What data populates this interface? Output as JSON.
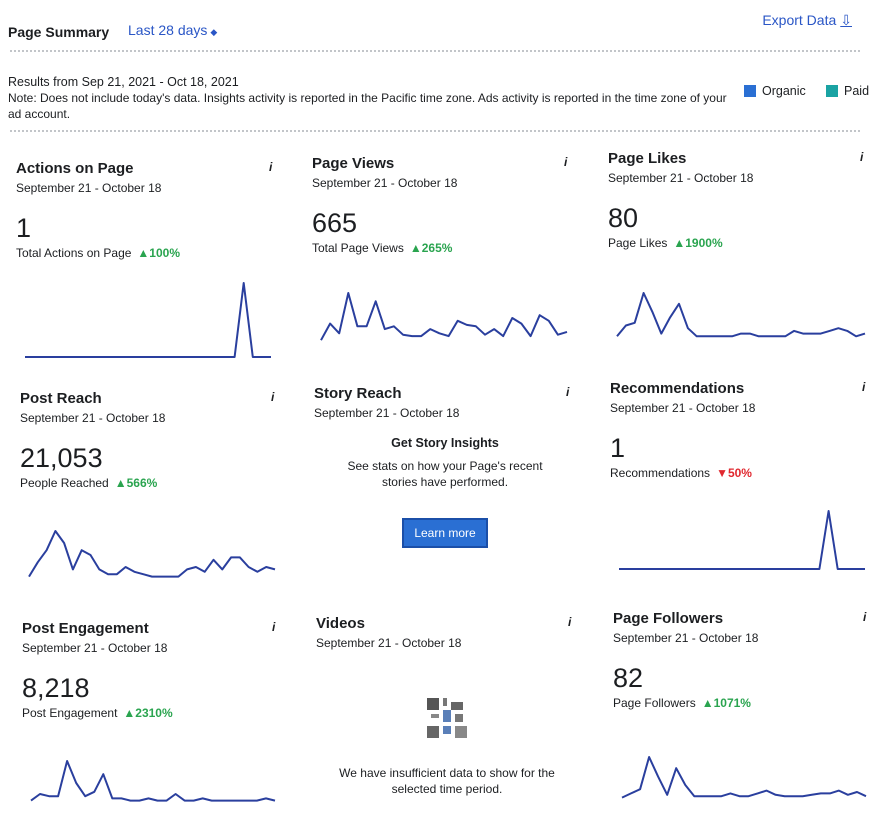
{
  "header": {
    "title": "Page Summary",
    "date_range": "Last 28 days",
    "export_label": "Export Data"
  },
  "results": {
    "line1": "Results from Sep 21, 2021 - Oct 18, 2021",
    "note": "Note: Does not include today's data. Insights activity is reported in the Pacific time zone. Ads activity is reported in the time zone of your ad account."
  },
  "legend": {
    "organic": "Organic",
    "paid": "Paid",
    "organic_color": "#2a6fd3",
    "paid_color": "#1aa3a3"
  },
  "accent_color": "#2a56c6",
  "info_glyph": "i",
  "cards": [
    {
      "title": "Actions on Page",
      "sub": "September 21 - October 18",
      "value": "1",
      "metric": "Total Actions on Page",
      "change": "▲100%",
      "direction": "up",
      "spark": [
        0,
        0,
        0,
        0,
        0,
        0,
        0,
        0,
        0,
        0,
        0,
        0,
        0,
        0,
        0,
        0,
        0,
        0,
        0,
        0,
        0,
        0,
        0,
        0,
        1,
        0,
        0,
        0
      ]
    },
    {
      "title": "Page Views",
      "sub": "September 21 - October 18",
      "value": "665",
      "metric": "Total Page Views",
      "change": "▲265%",
      "direction": "up",
      "spark": [
        2,
        14,
        7,
        36,
        12,
        12,
        30,
        10,
        12,
        6,
        5,
        5,
        10,
        7,
        5,
        16,
        13,
        12,
        6,
        10,
        5,
        18,
        14,
        5,
        20,
        16,
        6,
        8
      ]
    },
    {
      "title": "Page Likes",
      "sub": "September 21 - October 18",
      "value": "80",
      "metric": "Page Likes",
      "change": "▲1900%",
      "direction": "up",
      "spark": [
        1,
        5,
        6,
        17,
        10,
        2,
        8,
        13,
        4,
        1,
        1,
        1,
        1,
        1,
        2,
        2,
        1,
        1,
        1,
        1,
        3,
        2,
        2,
        2,
        3,
        4,
        3,
        1,
        2
      ]
    },
    {
      "title": "Post Reach",
      "sub": "September 21 - October 18",
      "value": "21,053",
      "metric": "People Reached",
      "change": "▲566%",
      "direction": "up",
      "spark": [
        1,
        7,
        12,
        20,
        15,
        4,
        12,
        10,
        4,
        2,
        2,
        5,
        3,
        2,
        1,
        1,
        1,
        1,
        4,
        5,
        3,
        8,
        4,
        9,
        9,
        5,
        3,
        5,
        4
      ]
    },
    {
      "title": "Story Reach",
      "sub": "September 21 - October 18",
      "story_heading": "Get Story Insights",
      "story_text": "See stats on how your Page's recent stories have performed.",
      "button": "Learn more"
    },
    {
      "title": "Recommendations",
      "sub": "September 21 - October 18",
      "value": "1",
      "metric": "Recommendations",
      "change": "▼50%",
      "direction": "down",
      "spark": [
        0,
        0,
        0,
        0,
        0,
        0,
        0,
        0,
        0,
        0,
        0,
        0,
        0,
        0,
        0,
        0,
        0,
        0,
        0,
        0,
        0,
        0,
        0,
        1,
        0,
        0,
        0,
        0
      ]
    },
    {
      "title": "Post Engagement",
      "sub": "September 21 - October 18",
      "value": "8,218",
      "metric": "Post Engagement",
      "change": "▲2310%",
      "direction": "up",
      "spark": [
        2,
        5,
        4,
        4,
        20,
        10,
        4,
        6,
        14,
        3,
        3,
        2,
        2,
        3,
        2,
        2,
        5,
        2,
        2,
        3,
        2,
        2,
        2,
        2,
        2,
        2,
        3,
        2
      ]
    },
    {
      "title": "Videos",
      "sub": "September 21 - October 18",
      "videos_text": "We have insufficient data to show for the selected time period."
    },
    {
      "title": "Page Followers",
      "sub": "September 21 - October 18",
      "value": "82",
      "metric": "Page Followers",
      "change": "▲1071%",
      "direction": "up",
      "spark": [
        1,
        4,
        7,
        30,
        16,
        3,
        22,
        10,
        2,
        2,
        2,
        2,
        4,
        2,
        2,
        4,
        6,
        3,
        2,
        2,
        2,
        3,
        4,
        4,
        6,
        3,
        5,
        2
      ]
    }
  ]
}
